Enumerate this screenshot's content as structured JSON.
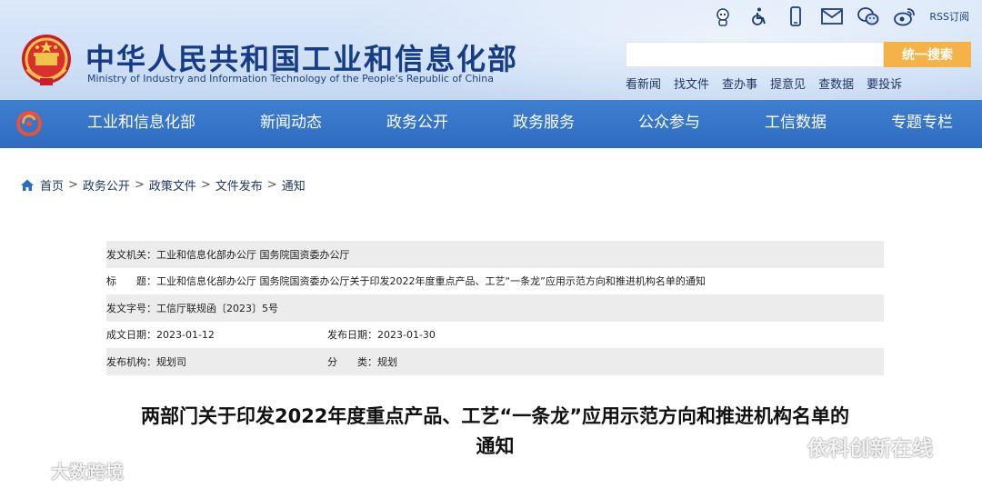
{
  "header": {
    "site_title": "中华人民共和国工业和信息化部",
    "site_subtitle": "Ministry of Industry and Information Technology of the People's Republic of China",
    "rss_label": "RSS订阅",
    "search_button": "统一搜索",
    "search_value": "",
    "quick_links": [
      "看新闻",
      "找文件",
      "查办事",
      "提意见",
      "查数据",
      "要投诉"
    ],
    "utility_icons": [
      "robot-assistant-icon",
      "accessibility-icon",
      "mobile-icon",
      "email-icon",
      "wechat-icon",
      "weibo-icon"
    ]
  },
  "nav": {
    "items": [
      "工业和信息化部",
      "新闻动态",
      "政务公开",
      "政务服务",
      "公众参与",
      "工信数据",
      "专题专栏"
    ]
  },
  "breadcrumb": {
    "items": [
      "首页",
      "政务公开",
      "政策文件",
      "文件发布",
      "通知"
    ],
    "separator": ">"
  },
  "meta": {
    "issuer_label": "发文机关：",
    "issuer": "工业和信息化部办公厅 国务院国资委办公厅",
    "title_label": "标　　题：",
    "title": "工业和信息化部办公厅 国务院国资委办公厅关于印发2022年度重点产品、工艺“一条龙”应用示范方向和推进机构名单的通知",
    "doc_no_label": "发文字号：",
    "doc_no": "工信厅联规函〔2023〕5号",
    "created_label": "成文日期：",
    "created": "2023-01-12",
    "published_label": "发布日期：",
    "published": "2023-01-30",
    "agency_label": "发布机构：",
    "agency": "规划司",
    "category_label": "分　　类：",
    "category": "规划"
  },
  "document": {
    "title_line1": "两部门关于印发2022年度重点产品、工艺“一条龙”应用示范方向和推进机构名单的",
    "title_line2": "通知"
  },
  "watermarks": {
    "left": "大数跨境",
    "right": "依科创新在线"
  },
  "colors": {
    "header_bg": "#cfe0f6",
    "nav_bg": "#2d6cc0",
    "search_button": "#f5b247",
    "title_blue": "#153c84",
    "meta_shade": "#ececec"
  }
}
